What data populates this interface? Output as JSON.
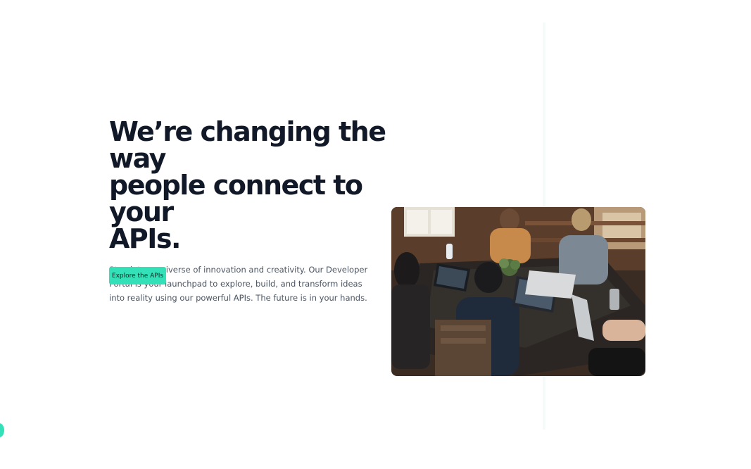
{
  "hero": {
    "headline_line1": "We’re changing the way",
    "headline_line2": "people connect to your",
    "headline_line3": "APIs.",
    "description": "Step into a universe of innovation and creativity. Our Developer Portal is your launchpad to explore, build, and transform ideas into reality using our powerful APIs. The future is in your hands.",
    "cta_label": "Explore the APIs"
  },
  "colors": {
    "accent": "#34e0b8",
    "heading": "#111827",
    "body_text": "#4b5563"
  },
  "icons": {
    "chat_launcher": "chat-bubble-icon"
  }
}
